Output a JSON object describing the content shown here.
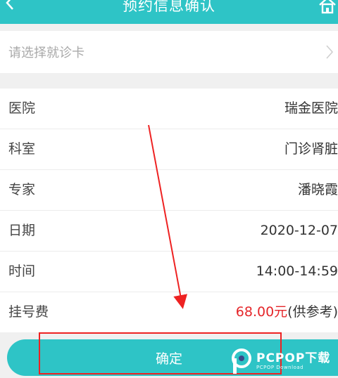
{
  "header": {
    "title": "预约信息确认"
  },
  "card_select": {
    "placeholder": "请选择就诊卡"
  },
  "info_rows": [
    {
      "label": "医院",
      "value": "瑞金医院"
    },
    {
      "label": "科室",
      "value": "门诊肾脏"
    },
    {
      "label": "专家",
      "value": "潘晓霞"
    },
    {
      "label": "日期",
      "value": "2020-12-07"
    },
    {
      "label": "时间",
      "value": "14:00-14:59"
    },
    {
      "label": "挂号费",
      "price": "68.00元",
      "note": "(供参考)"
    }
  ],
  "confirm_button": {
    "label": "确定"
  },
  "watermark": {
    "text": "PCPOP下载",
    "subtext": "PCPOP Download"
  },
  "colors": {
    "accent": "#2ec4c6",
    "price": "#e5262a",
    "annotation": "#e22222"
  }
}
